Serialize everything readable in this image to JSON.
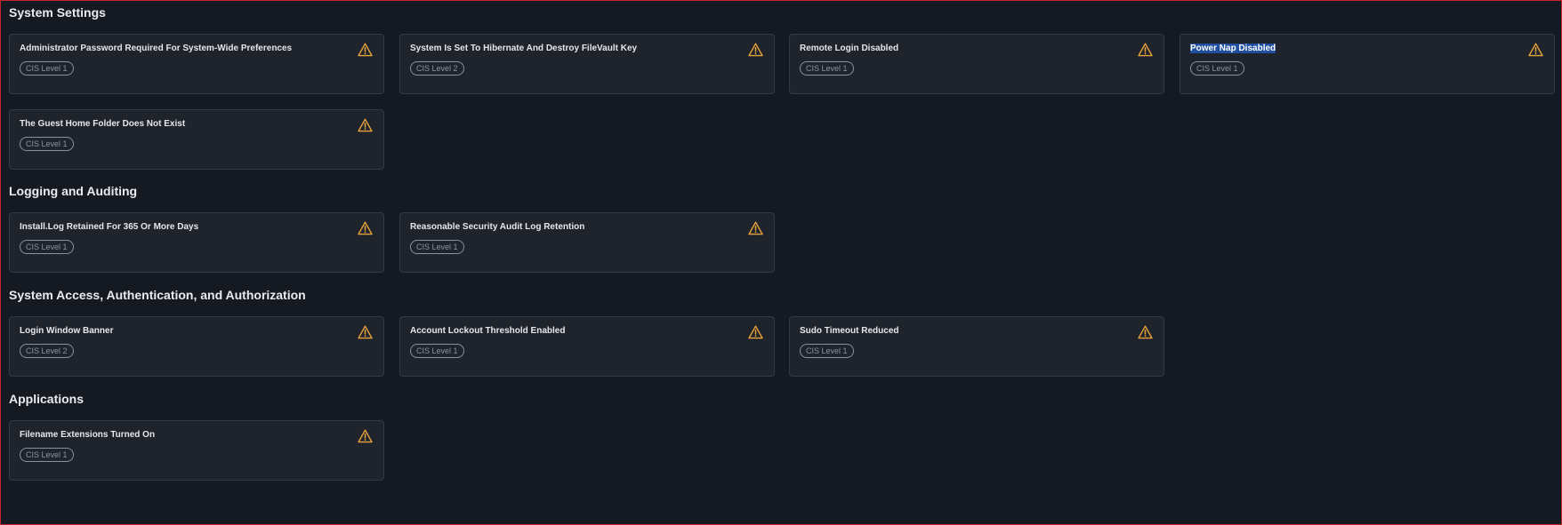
{
  "colors": {
    "background": "#151a22",
    "card": "#1f242c",
    "card_border": "#343a44",
    "warning": "#e8a23a",
    "badge": "#8b93a0",
    "selection": "#1f4f9e",
    "frame": "#c8232c"
  },
  "sections": [
    {
      "title": "System Settings",
      "cards": [
        {
          "title": "Administrator Password Required For System-Wide Preferences",
          "badge": "CIS Level 1",
          "icon": "warning-icon"
        },
        {
          "title": "System Is Set To Hibernate And Destroy FileVault Key",
          "badge": "CIS Level 2",
          "icon": "warning-icon"
        },
        {
          "title": "Remote Login Disabled",
          "badge": "CIS Level 1",
          "icon": "warning-icon"
        },
        {
          "title": "Power Nap Disabled",
          "badge": "CIS Level 1",
          "icon": "warning-icon",
          "selected": true
        },
        {
          "title": "The Guest Home Folder Does Not Exist",
          "badge": "CIS Level 1",
          "icon": "warning-icon"
        }
      ]
    },
    {
      "title": "Logging and Auditing",
      "cards": [
        {
          "title": "Install.Log Retained For 365 Or More Days",
          "badge": "CIS Level 1",
          "icon": "warning-icon"
        },
        {
          "title": "Reasonable Security Audit Log Retention",
          "badge": "CIS Level 1",
          "icon": "warning-icon"
        }
      ]
    },
    {
      "title": "System Access, Authentication, and Authorization",
      "cards": [
        {
          "title": "Login Window Banner",
          "badge": "CIS Level 2",
          "icon": "warning-icon"
        },
        {
          "title": "Account Lockout Threshold Enabled",
          "badge": "CIS Level 1",
          "icon": "warning-icon"
        },
        {
          "title": "Sudo Timeout Reduced",
          "badge": "CIS Level 1",
          "icon": "warning-icon"
        }
      ]
    },
    {
      "title": "Applications",
      "cards": [
        {
          "title": "Filename Extensions Turned On",
          "badge": "CIS Level 1",
          "icon": "warning-icon"
        }
      ]
    }
  ]
}
